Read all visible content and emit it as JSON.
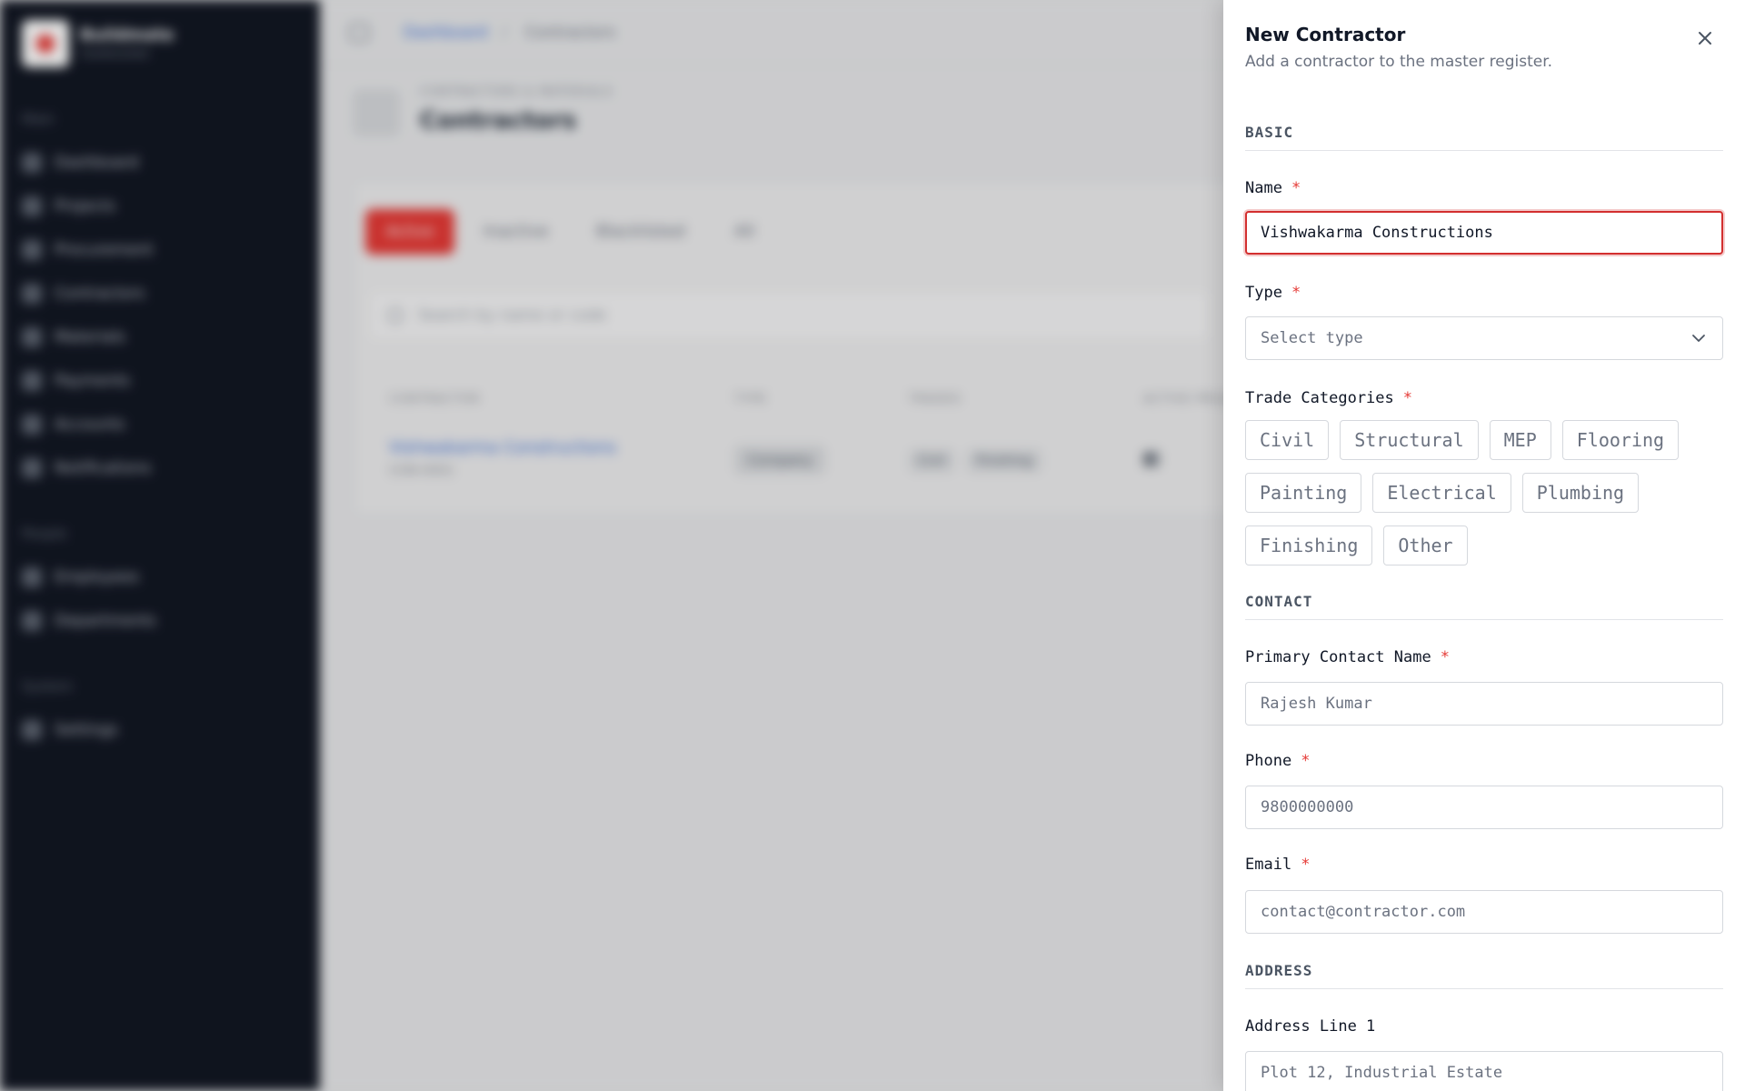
{
  "app": {
    "brand": "Buildmate",
    "brand_sub": "Construction",
    "sections": {
      "main": "Main",
      "people": "People",
      "system": "System"
    },
    "nav": [
      "Dashboard",
      "Projects",
      "Procurement",
      "Contractors",
      "Materials",
      "Payments",
      "Accounts",
      "Notifications"
    ],
    "people_nav": [
      "Employees",
      "Departments"
    ],
    "system_nav": [
      "Settings"
    ],
    "breadcrumb": [
      "Dashboard",
      "Contractors"
    ],
    "page_over": "CONTRACTORS & MATERIALS",
    "page_title": "Contractors",
    "tabs": [
      "Active",
      "Inactive",
      "Blacklisted",
      "All"
    ],
    "search_placeholder": "Search by name or code",
    "table_headers": [
      "CONTRACTOR",
      "TYPE",
      "TRADES",
      "ACTIVE PROJECTS"
    ],
    "row": {
      "name": "Vishwakarma Constructions",
      "code": "CON-0001",
      "type": "Company",
      "trades": [
        "Civil",
        "Finishing"
      ],
      "projects": "0"
    }
  },
  "drawer": {
    "title": "New Contractor",
    "subtitle": "Add a contractor to the master register.",
    "required_mark": "*",
    "sections": {
      "basic": "BASIC",
      "contact": "CONTACT",
      "address": "ADDRESS"
    },
    "fields": {
      "name": {
        "label": "Name",
        "value": "Vishwakarma Constructions"
      },
      "type": {
        "label": "Type",
        "placeholder": "Select type"
      },
      "trades": {
        "label": "Trade Categories",
        "options": [
          "Civil",
          "Structural",
          "MEP",
          "Flooring",
          "Painting",
          "Electrical",
          "Plumbing",
          "Finishing",
          "Other"
        ]
      },
      "contact_name": {
        "label": "Primary Contact Name",
        "placeholder": "Rajesh Kumar"
      },
      "phone": {
        "label": "Phone",
        "placeholder": "9800000000"
      },
      "email": {
        "label": "Email",
        "placeholder": "contact@contractor.com"
      },
      "address1": {
        "label": "Address Line 1",
        "placeholder": "Plot 12, Industrial Estate"
      }
    }
  },
  "colors": {
    "accent": "#e53935",
    "sidebar_bg": "#121723",
    "link": "#3b6fd8"
  }
}
